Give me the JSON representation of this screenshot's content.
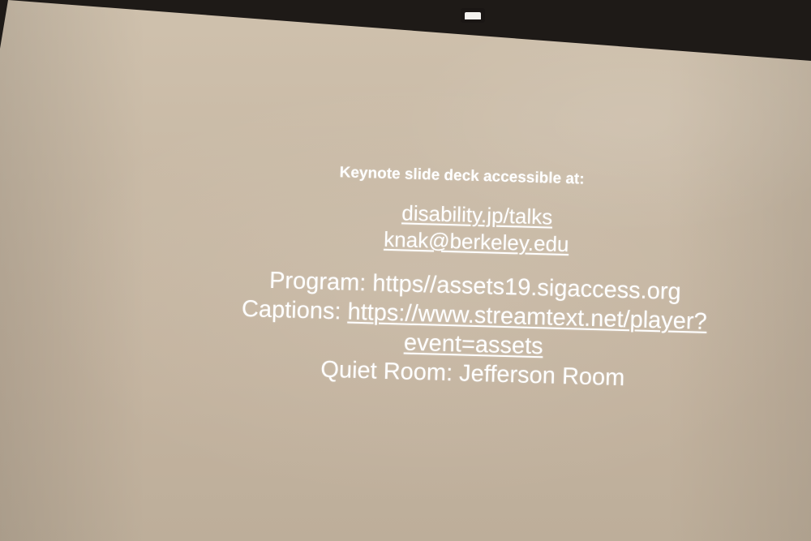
{
  "slide": {
    "intro": "Keynote slide deck accessible at:",
    "link_talks": "disability.jp/talks",
    "link_email": "knak@berkeley.edu",
    "program_label": "Program:",
    "program_value": "https//assets19.sigaccess.org",
    "captions_label": "Captions:",
    "captions_url_part1": "https://www.streamtext.net/player?",
    "captions_url_part2": "event=assets",
    "quiet_room": "Quiet Room: Jefferson Room"
  }
}
